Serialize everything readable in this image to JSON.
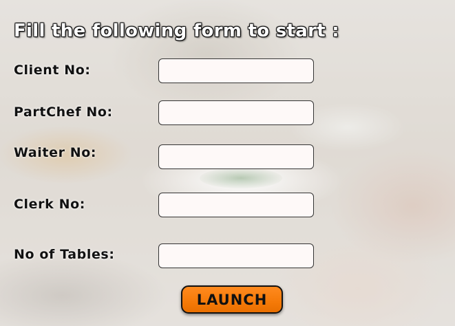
{
  "form": {
    "title": "Fill the following form to start :",
    "fields": [
      {
        "label": "Client No:",
        "value": ""
      },
      {
        "label": "PartChef No:",
        "value": ""
      },
      {
        "label": "Waiter No:",
        "value": ""
      },
      {
        "label": "Clerk No:",
        "value": ""
      },
      {
        "label": "No of Tables:",
        "value": ""
      }
    ],
    "launch_label": "LAUNCH"
  },
  "colors": {
    "launch_button": "#f57a08",
    "field_background": "#fef9f8",
    "title_text": "#ffffff",
    "label_text": "#111111"
  }
}
